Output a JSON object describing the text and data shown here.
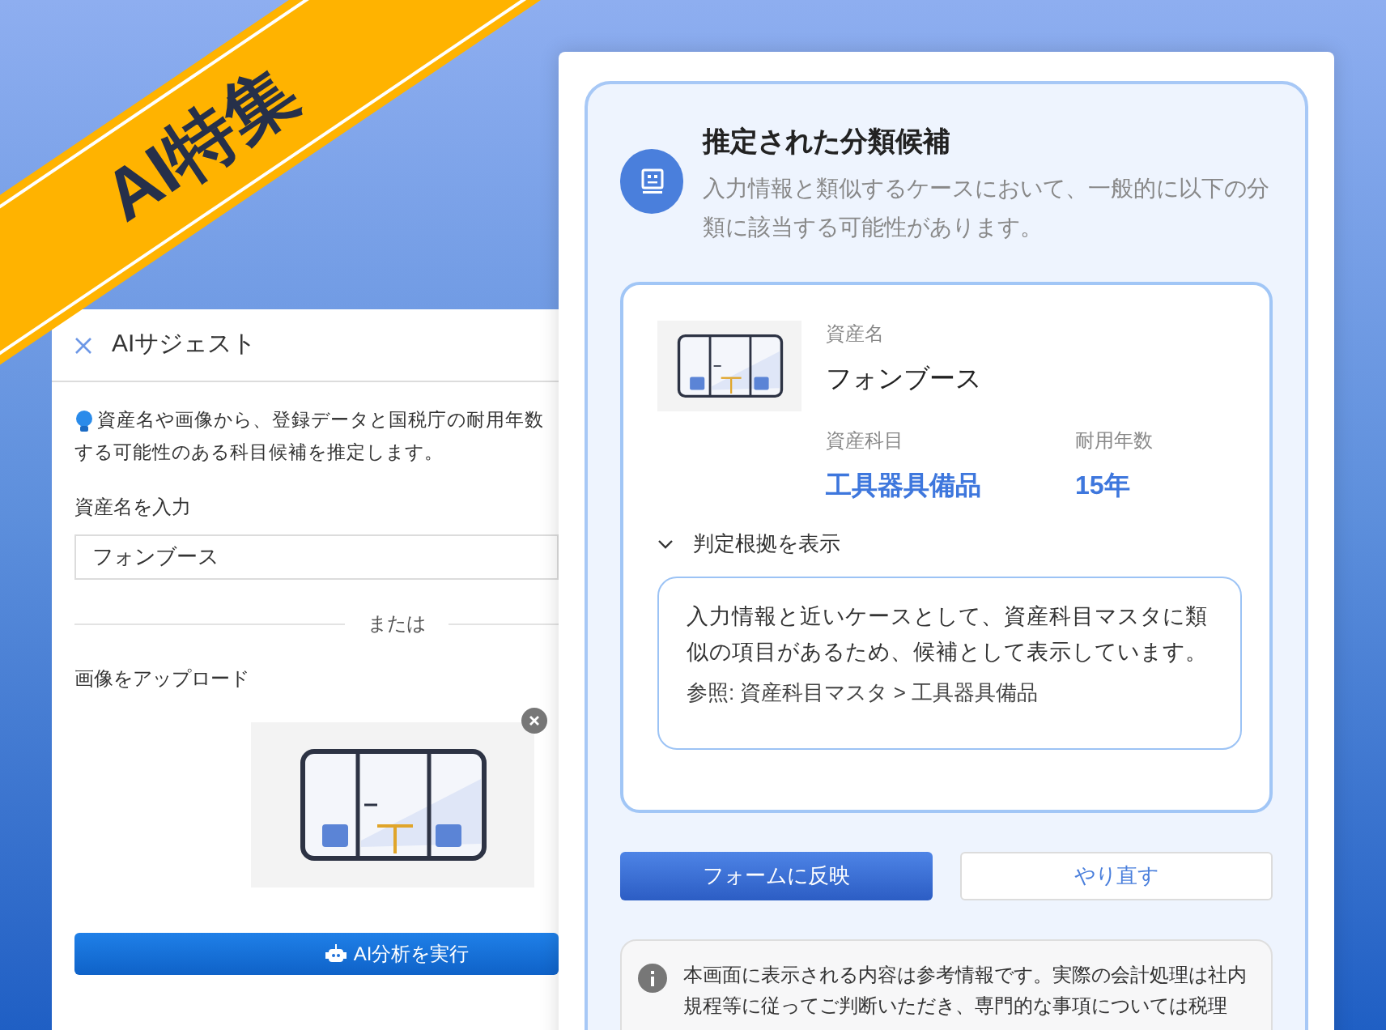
{
  "banner": {
    "text": "AI特集"
  },
  "suggest_panel": {
    "title": "AIサジェスト",
    "description_lines": [
      "資産名や画像から、登録データと国税庁の耐用年数",
      "する可能性のある科目候補を推定します。"
    ],
    "name_label": "資産名を入力",
    "name_value": "フォンブース",
    "divider_text": "または",
    "upload_label": "画像をアップロード",
    "run_button": "AI分析を実行"
  },
  "result_panel": {
    "title": "推定された分類候補",
    "description": "入力情報と類似するケースにおいて、一般的に以下の分類に該当する可能性があります。",
    "fields": [
      {
        "label": "資産名",
        "value": "フォンブース",
        "kind": "plain"
      },
      {
        "label": "資産科目",
        "value": "工具器具備品",
        "kind": "highlight"
      },
      {
        "label": "耐用年数",
        "value": "15年",
        "kind": "highlight"
      }
    ],
    "reason": {
      "toggle": "判定根拠を表示",
      "expanded": true,
      "text": "入力情報と近いケースとして、資産科目マスタに類似の項目があるため、候補として表示しています。",
      "reference": "参照: 資産科目マスタ > 工具器具備品"
    },
    "buttons": [
      {
        "label": "フォームに反映",
        "kind": "primary"
      },
      {
        "label": "やり直す",
        "kind": "secondary"
      }
    ],
    "notice": "本画面に表示される内容は参考情報です。実際の会計処理は社内規程等に従ってご判断いただき、専門的な事項については税理"
  }
}
